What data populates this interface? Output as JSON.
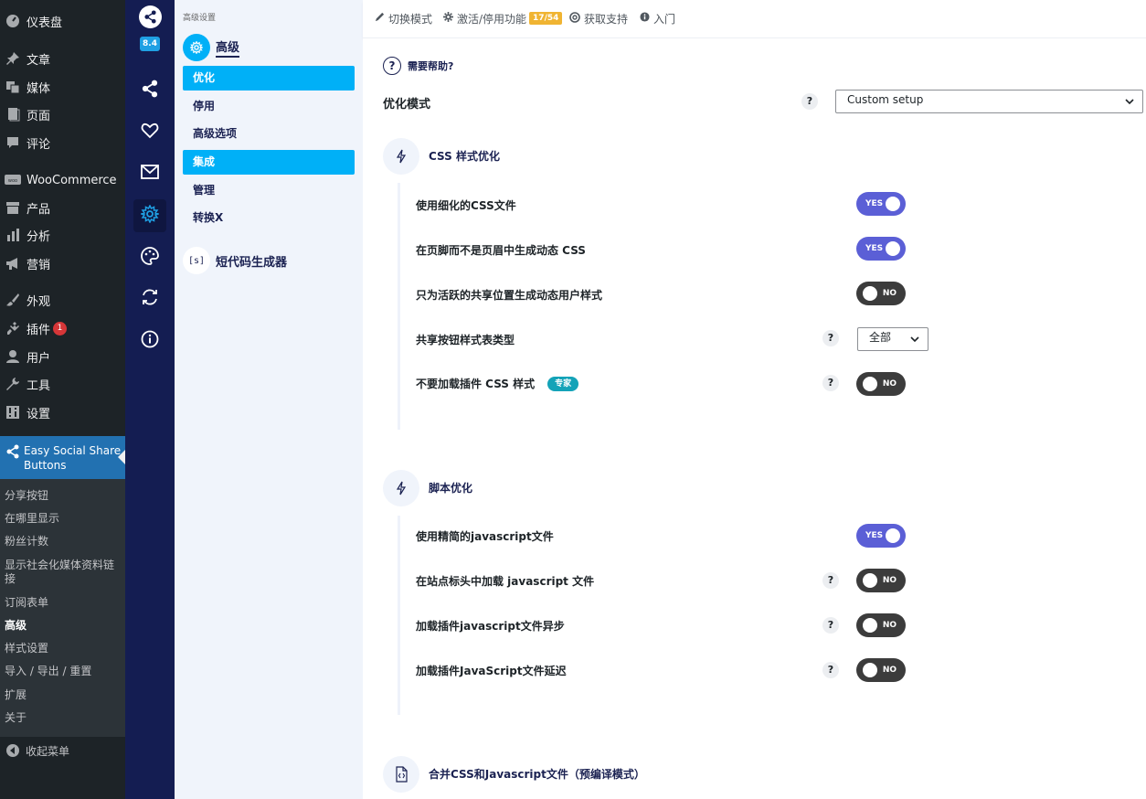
{
  "wp_menu": {
    "dashboard": "仪表盘",
    "posts": "文章",
    "media": "媒体",
    "pages": "页面",
    "comments": "评论",
    "woocommerce": "WooCommerce",
    "products": "产品",
    "analytics": "分析",
    "marketing": "营销",
    "appearance": "外观",
    "plugins": "插件",
    "plugins_badge": "1",
    "users": "用户",
    "tools": "工具",
    "settings": "设置",
    "active": "Easy Social Share Buttons",
    "submenu": [
      "分享按钮",
      "在哪里显示",
      "粉丝计数",
      "显示社会化媒体资料链接",
      "订阅表单",
      "高级",
      "样式设置",
      "导入 / 导出 / 重置",
      "扩展",
      "关于"
    ],
    "submenu_current": "高级",
    "collapse": "收起菜单"
  },
  "plugin_rail": {
    "version": "8.4",
    "icons": [
      "share-icon",
      "heart-icon",
      "mail-icon",
      "gear-icon",
      "palette-icon",
      "refresh-icon",
      "info-icon"
    ]
  },
  "plugin_nav": {
    "kicker": "高级设置",
    "section_title": "高级",
    "items": [
      "优化",
      "停用",
      "高级选项",
      "集成",
      "管理",
      "转换X"
    ],
    "shortcode_title": "短代码生成器",
    "shortcode_icon": "[s]"
  },
  "topbar": {
    "switch_mode": "切换模式",
    "features": "激活/停用功能",
    "features_count": "17/54",
    "support": "获取支持",
    "getting_started": "入门"
  },
  "main": {
    "help": "需要帮助?",
    "mode_label": "优化模式",
    "mode_value": "Custom setup",
    "css_section": {
      "title": "CSS 样式优化",
      "options": [
        {
          "label": "使用细化的CSS文件",
          "state": "YES"
        },
        {
          "label": "在页脚而不是页眉中生成动态 CSS",
          "state": "YES"
        },
        {
          "label": "只为活跃的共享位置生成动态用户样式",
          "state": "NO"
        },
        {
          "label": "共享按钮样式表类型",
          "select": "全部"
        },
        {
          "label": "不要加载插件 CSS 样式",
          "tag": "专家",
          "state": "NO"
        }
      ]
    },
    "js_section": {
      "title": "脚本优化",
      "options": [
        {
          "label": "使用精简的javascript文件",
          "state": "YES"
        },
        {
          "label": "在站点标头中加载 javascript 文件",
          "state": "NO"
        },
        {
          "label": "加载插件javascript文件异步",
          "state": "NO"
        },
        {
          "label": "加载插件JavaScript文件延迟",
          "state": "NO"
        }
      ]
    },
    "merge_section": {
      "title": "合并CSS和Javascript文件（预编译模式）"
    }
  },
  "colors": {
    "wp_bg": "#1d2327",
    "wp_active": "#2271b1",
    "rail_bg": "#141d52",
    "nav_selected": "#00b0f7",
    "toggle_on": "#5b5fd6",
    "toggle_off": "#3c3c3c",
    "badge": "#f0b432",
    "pro_tag": "#14a3b8"
  }
}
